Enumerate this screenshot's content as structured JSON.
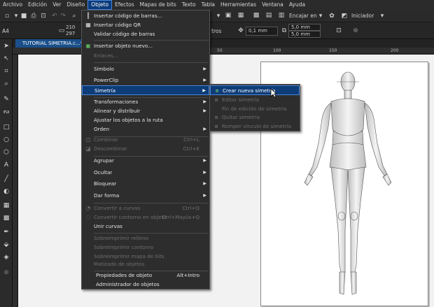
{
  "menubar": [
    "Archivo",
    "Edición",
    "Ver",
    "Diseño",
    "Objeto",
    "Efectos",
    "Mapas de bits",
    "Texto",
    "Tabla",
    "Herramientas",
    "Ventana",
    "Ayuda"
  ],
  "toolbar": {
    "snap_label": "Encajar en",
    "launcher_label": "Iniciador"
  },
  "propbar": {
    "page_size": "A4",
    "w_partial": "210",
    "h_partial": "297",
    "units_partial": "tros",
    "nudge": "0,1 mm",
    "dup_x": "5,0 mm",
    "dup_y": "5,0 mm"
  },
  "doctab": {
    "label": "TUTORIAL SIMETRIA.c...*"
  },
  "ruler": {
    "h_marks": [
      "50",
      "100",
      "150",
      "200"
    ],
    "v_marks": [
      "300",
      "250",
      "200",
      "150",
      "100",
      "50"
    ]
  },
  "objeto_menu": {
    "items": [
      {
        "label": "Insertar código de barras...",
        "disabled": false,
        "icon": "barcode-icon"
      },
      {
        "label": "Insertar código QR",
        "disabled": false,
        "icon": "qr-icon"
      },
      {
        "label": "Validar código de barras",
        "disabled": false
      },
      {
        "label": "Insertar objeto nuevo...",
        "disabled": false,
        "icon": "insert-object-icon"
      },
      {
        "label": "Enlaces...",
        "disabled": true
      },
      {
        "label": "Símbolo",
        "disabled": false,
        "submenu": true
      },
      {
        "label": "PowerClip",
        "disabled": false,
        "submenu": true
      },
      {
        "label": "Simetría",
        "disabled": false,
        "submenu": true,
        "highlight": true
      },
      {
        "label": "Transformaciones",
        "disabled": false,
        "submenu": true
      },
      {
        "label": "Alinear y distribuir",
        "disabled": false,
        "submenu": true
      },
      {
        "label": "Ajustar los objetos a la ruta",
        "disabled": false
      },
      {
        "label": "Orden",
        "disabled": false,
        "submenu": true
      },
      {
        "label": "Combinar",
        "disabled": true,
        "shortcut": "Ctrl+L",
        "icon": "combine-icon"
      },
      {
        "label": "Descombinar",
        "disabled": true,
        "shortcut": "Ctrl+K",
        "icon": "break-apart-icon"
      },
      {
        "label": "Agrupar",
        "disabled": false,
        "submenu": true
      },
      {
        "label": "Ocultar",
        "disabled": false,
        "submenu": true
      },
      {
        "label": "Bloquear",
        "disabled": false,
        "submenu": true
      },
      {
        "label": "Dar forma",
        "disabled": false,
        "submenu": true
      },
      {
        "label": "Convertir a curvas",
        "disabled": true,
        "shortcut": "Ctrl+Q",
        "icon": "convert-curves-icon"
      },
      {
        "label": "Convertir contorno en objeto",
        "disabled": true,
        "shortcut": "Ctrl+Mayús+Q",
        "icon": "outline-object-icon"
      },
      {
        "label": "Unir curvas",
        "disabled": false
      },
      {
        "label": "Sobreimprimir relleno",
        "disabled": true
      },
      {
        "label": "Sobreimprimir contorno",
        "disabled": true
      },
      {
        "label": "Sobreimprimir mapa de bits",
        "disabled": true
      },
      {
        "label": "Matizado de objetos",
        "disabled": true
      },
      {
        "label": "Propiedades de objeto",
        "disabled": false,
        "shortcut": "Alt+Intro"
      },
      {
        "label": "Administrador de objetos",
        "disabled": false
      }
    ]
  },
  "simetria_submenu": {
    "items": [
      {
        "label": "Crear nueva simetría",
        "disabled": false,
        "highlight": true,
        "icon": "symmetry-new-icon"
      },
      {
        "label": "Editar simetría",
        "disabled": true,
        "icon": "symmetry-edit-icon"
      },
      {
        "label": "Fin de edición de simetría",
        "disabled": true
      },
      {
        "label": "Quitar simetría",
        "disabled": true,
        "icon": "symmetry-remove-icon"
      },
      {
        "label": "Romper vínculo de simetría",
        "disabled": true,
        "icon": "symmetry-break-icon"
      }
    ]
  },
  "colors": {
    "menu_bg": "#2d2d2d",
    "highlight": "#0d3c78",
    "highlight_border": "#4a86d8",
    "canvas": "#f2f2f2"
  }
}
